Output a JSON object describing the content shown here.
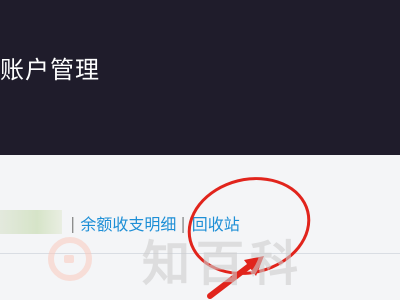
{
  "header": {
    "title": "账户管理"
  },
  "toolbar": {
    "separator": "|",
    "balance_detail_label": "余额收支明细",
    "recycle_bin_label": "回收站"
  },
  "watermark": {
    "text": "知百科"
  },
  "colors": {
    "header_bg": "#1f1c2b",
    "link": "#1e8fd6",
    "annotation": "#e1241c"
  }
}
